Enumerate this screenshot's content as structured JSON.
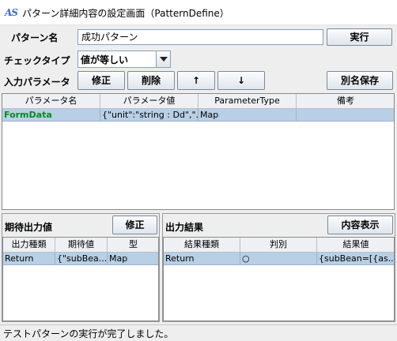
{
  "window": {
    "title": "パターン詳細内容の設定画面（PatternDefine）",
    "icon_text": "AS",
    "icon_name": "app-icon"
  },
  "form": {
    "pattern_name_label": "パターン名",
    "pattern_name_value": "成功パターン",
    "execute_button": "実行",
    "check_type_label": "チェックタイプ",
    "check_type_value": "値が等しい",
    "input_params_label": "入力パラメータ",
    "edit_button": "修正",
    "delete_button": "削除",
    "up_button": "↑",
    "down_button": "↓",
    "save_as_button": "別名保存"
  },
  "params_table": {
    "columns": [
      "パラメータ名",
      "パラメータ値",
      "ParameterType",
      "備考"
    ],
    "rows": [
      {
        "name": "FormData",
        "value": "{\"unit\":\"string : Dd\",\"...",
        "type": "Map",
        "note": ""
      }
    ],
    "name_color": "#0a8a1a"
  },
  "expected": {
    "title": "期待出力値",
    "edit_button": "修正",
    "columns": [
      "出力種類",
      "期待値",
      "型"
    ],
    "rows": [
      {
        "kind": "Return",
        "value": "{\"subBea...",
        "type": "Map"
      }
    ]
  },
  "output": {
    "title": "出力結果",
    "show_button": "内容表示",
    "columns": [
      "結果種類",
      "判別",
      "結果値"
    ],
    "rows": [
      {
        "kind": "Return",
        "judge": "○",
        "value": "{subBean=[{as..."
      }
    ]
  },
  "status": {
    "message": "テストパターンの実行が完了しました。"
  },
  "colors": {
    "selection": "#b8cfe5",
    "background": "#eeeeee"
  }
}
